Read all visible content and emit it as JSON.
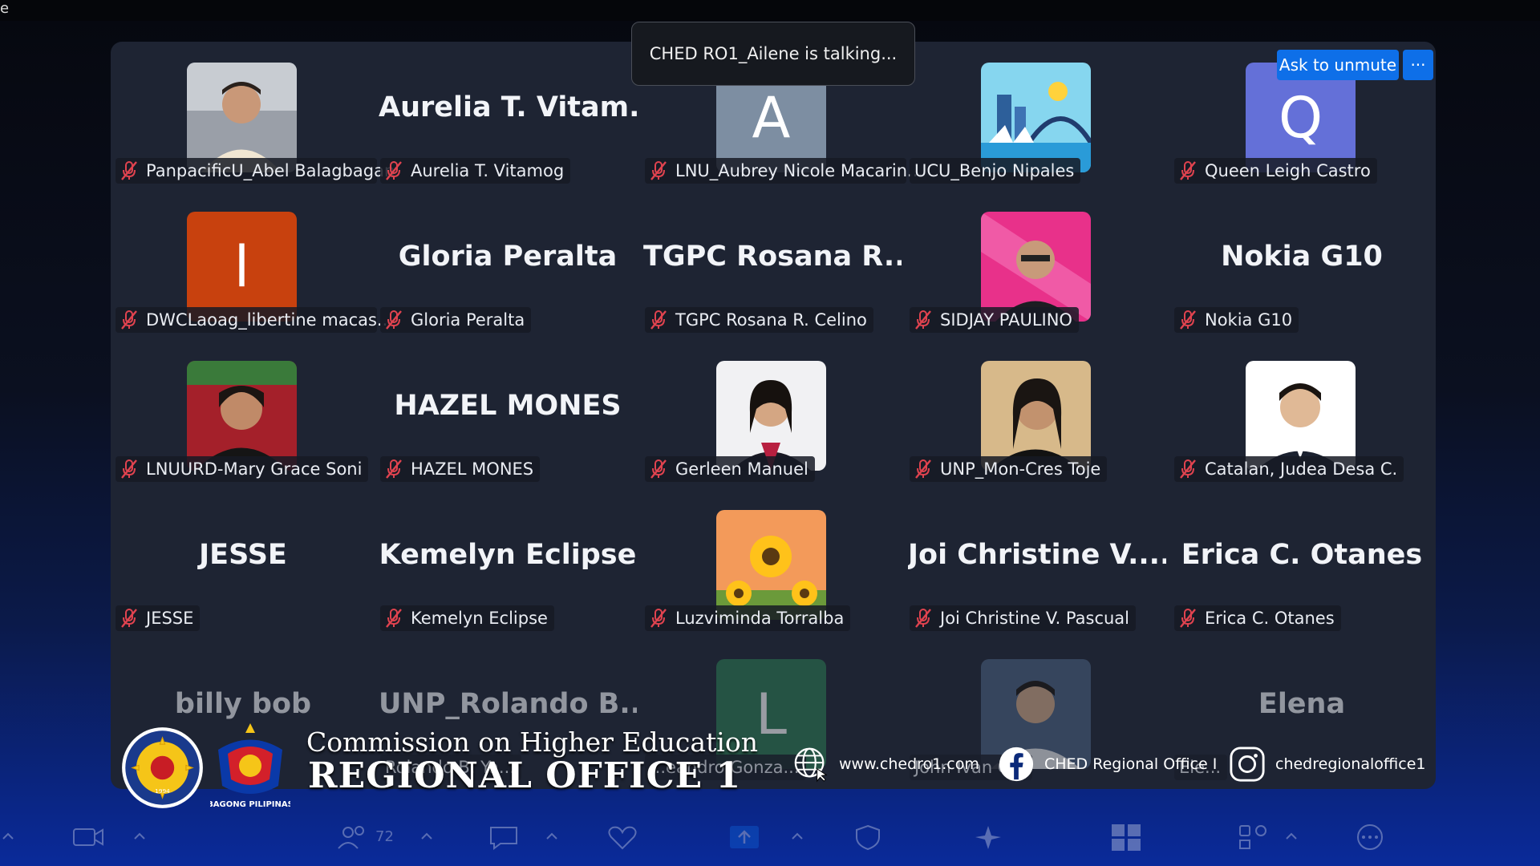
{
  "window": {
    "edge_glyph": "e"
  },
  "toast": {
    "text": "CHED RO1_Ailene is talking..."
  },
  "controls": {
    "ask_to_unmute": "Ask to unmute",
    "more": "···"
  },
  "participants": [
    {
      "name": "PanpacificU_Abel Balagbagan",
      "display": "photo",
      "photo_theme": "man-barong",
      "muted": true
    },
    {
      "name": "Aurelia T. Vitamog",
      "display": "name",
      "big_name": "Aurelia T. Vitam...",
      "muted": true
    },
    {
      "name": "LNU_Aubrey Nicole Macarin...",
      "display": "letter",
      "letter": "A",
      "color": "#7d8ea2",
      "muted": true
    },
    {
      "name": "UCU_Benjo Nipales",
      "display": "photo",
      "photo_theme": "sydney-icon",
      "muted": false
    },
    {
      "name": "Queen Leigh Castro",
      "display": "letter",
      "letter": "Q",
      "color": "#6470d8",
      "muted": true
    },
    {
      "name": "DWCLaoag_libertine macas...",
      "display": "letter",
      "letter": "l",
      "color": "#c8410e",
      "muted": true
    },
    {
      "name": "Gloria Peralta",
      "display": "name",
      "big_name": "Gloria Peralta",
      "muted": true
    },
    {
      "name": "TGPC Rosana R. Celino",
      "display": "name",
      "big_name": "TGPC Rosana R....",
      "muted": true
    },
    {
      "name": "SIDJAY PAULINO",
      "display": "photo",
      "photo_theme": "man-pink",
      "muted": true
    },
    {
      "name": "Nokia G10",
      "display": "name",
      "big_name": "Nokia G10",
      "muted": true
    },
    {
      "name": "LNUURD-Mary Grace Soni",
      "display": "photo",
      "photo_theme": "woman-red",
      "muted": true
    },
    {
      "name": "HAZEL MONES",
      "display": "name",
      "big_name": "HAZEL MONES",
      "muted": true
    },
    {
      "name": "Gerleen Manuel",
      "display": "photo",
      "photo_theme": "woman-formal",
      "muted": true
    },
    {
      "name": "UNP_Mon-Cres Toje",
      "display": "photo",
      "photo_theme": "woman-dark",
      "muted": true
    },
    {
      "name": "Catalan, Judea Desa C.",
      "display": "photo",
      "photo_theme": "man-formal",
      "muted": true
    },
    {
      "name": "JESSE",
      "display": "name",
      "big_name": "JESSE",
      "muted": true
    },
    {
      "name": "Kemelyn Eclipse",
      "display": "name",
      "big_name": "Kemelyn Eclipse",
      "muted": true
    },
    {
      "name": "Luzviminda Torralba",
      "display": "photo",
      "photo_theme": "sunflowers",
      "muted": true
    },
    {
      "name": "Joi Christine V. Pascual",
      "display": "name",
      "big_name": "Joi Christine V....",
      "muted": true
    },
    {
      "name": "Erica C. Otanes",
      "display": "name",
      "big_name": "Erica C. Otanes",
      "muted": true
    },
    {
      "name": "",
      "display": "name",
      "big_name": "billy bob",
      "muted": false
    },
    {
      "name": "Rolando B. Ya...",
      "display": "name",
      "big_name": "UNP_Rolando B...",
      "muted": false
    },
    {
      "name": "...eandro Gonza...",
      "display": "letter",
      "letter": "L",
      "color": "#2c7a52",
      "muted": false
    },
    {
      "name": "John Ivan C...",
      "display": "photo",
      "photo_theme": "man-white",
      "muted": false
    },
    {
      "name": "Ele...",
      "display": "name",
      "big_name": "Elena",
      "muted": false
    }
  ],
  "banner": {
    "line1": "Commission on Higher Education",
    "line2": "REGIONAL OFFICE 1",
    "bp_label": "BAGONG PILIPINAS",
    "seal_year": "1994",
    "website": "www.chedro1.com",
    "facebook": "CHED Regional Office I",
    "instagram": "chedregionaloffice1"
  },
  "toolbar": {
    "participants_count": "72"
  },
  "colors": {
    "accent_blue": "#0e6fe8",
    "muted_red": "#e0434f",
    "tile_bg": "#1e2433"
  }
}
